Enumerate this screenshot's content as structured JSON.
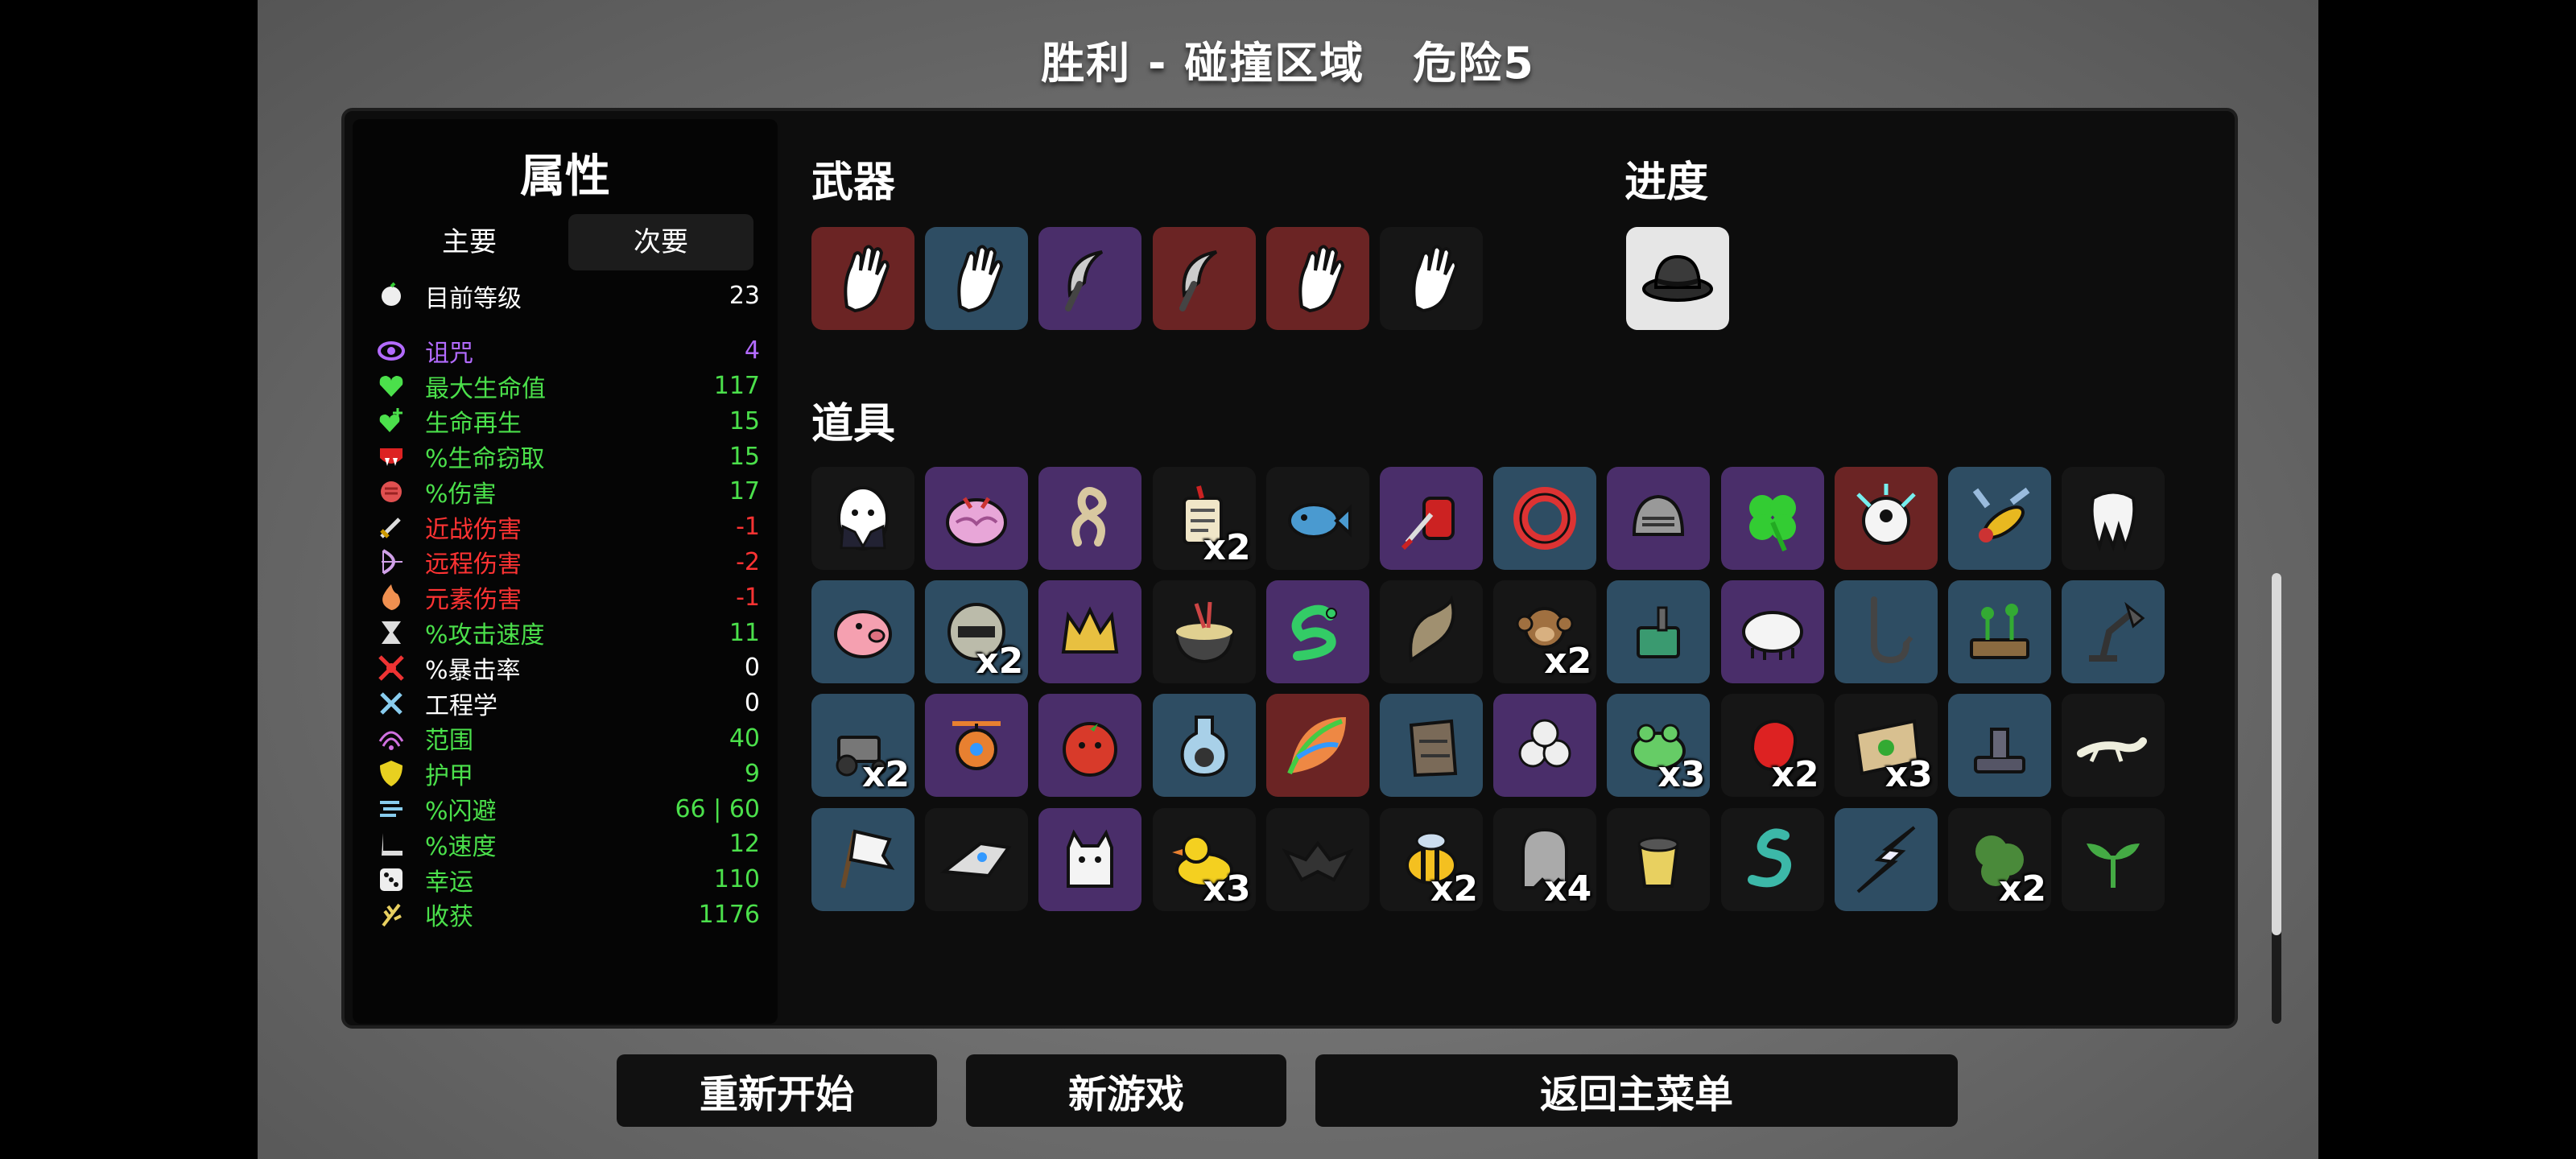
{
  "header": {
    "result": "胜利 - 碰撞区域",
    "danger": "危险5"
  },
  "stats": {
    "title": "属性",
    "tabs": [
      "主要",
      "次要"
    ],
    "active_tab": "次要",
    "level": {
      "label": "目前等级",
      "value": "23",
      "icon": "level-icon"
    },
    "items": [
      {
        "label": "诅咒",
        "value": "4",
        "color": "#b36bff",
        "icon": "curse-eye-icon"
      },
      {
        "label": "最大生命值",
        "value": "117",
        "color": "#4be04b",
        "icon": "heart-icon"
      },
      {
        "label": "生命再生",
        "value": "15",
        "color": "#4be04b",
        "icon": "regen-heart-icon"
      },
      {
        "label": "%生命窃取",
        "value": "15",
        "color": "#4be04b",
        "icon": "lifesteal-fangs-icon"
      },
      {
        "label": "%伤害",
        "value": "17",
        "color": "#4be04b",
        "icon": "damage-fist-icon"
      },
      {
        "label": "近战伤害",
        "value": "-1",
        "color": "#ff3333",
        "icon": "sword-icon"
      },
      {
        "label": "远程伤害",
        "value": "-2",
        "color": "#ff3333",
        "icon": "bow-icon"
      },
      {
        "label": "元素伤害",
        "value": "-1",
        "color": "#ff3333",
        "icon": "flame-icon"
      },
      {
        "label": "%攻击速度",
        "value": "11",
        "color": "#4be04b",
        "icon": "hourglass-icon"
      },
      {
        "label": "%暴击率",
        "value": "0",
        "color": "#ffffff",
        "icon": "crit-icon"
      },
      {
        "label": "工程学",
        "value": "0",
        "color": "#ffffff",
        "icon": "wrench-icon"
      },
      {
        "label": "范围",
        "value": "40",
        "color": "#4be04b",
        "icon": "range-icon"
      },
      {
        "label": "护甲",
        "value": "9",
        "color": "#4be04b",
        "icon": "shield-icon"
      },
      {
        "label": "%闪避",
        "value": "66 | 60",
        "color": "#4be04b",
        "icon": "dodge-icon"
      },
      {
        "label": "%速度",
        "value": "12",
        "color": "#4be04b",
        "icon": "boot-icon"
      },
      {
        "label": "幸运",
        "value": "110",
        "color": "#4be04b",
        "icon": "dice-icon"
      },
      {
        "label": "收获",
        "value": "1176",
        "color": "#4be04b",
        "icon": "harvest-icon"
      }
    ]
  },
  "weapons": {
    "title": "武器",
    "slots": [
      {
        "name": "hand-weapon",
        "tier": 4,
        "icon": "hand-icon"
      },
      {
        "name": "hand-weapon",
        "tier": 2,
        "icon": "hand-icon"
      },
      {
        "name": "sickle-weapon",
        "tier": 3,
        "icon": "sickle-icon"
      },
      {
        "name": "sickle-weapon",
        "tier": 4,
        "icon": "sickle-icon"
      },
      {
        "name": "hand-weapon",
        "tier": 4,
        "icon": "hand-icon"
      },
      {
        "name": "hand-weapon",
        "tier": 1,
        "icon": "hand-icon"
      }
    ]
  },
  "progress": {
    "title": "进度",
    "slots": [
      {
        "name": "bowler-hat",
        "icon": "bowler-hat-icon"
      }
    ]
  },
  "items": {
    "title": "道具",
    "slots": [
      {
        "tier": 1,
        "icon": "egg-icon",
        "qty": ""
      },
      {
        "tier": 3,
        "icon": "brain-icon",
        "qty": ""
      },
      {
        "tier": 3,
        "icon": "rope-icon",
        "qty": ""
      },
      {
        "tier": 1,
        "icon": "scroll-icon",
        "qty": "x2"
      },
      {
        "tier": 1,
        "icon": "fish-icon",
        "qty": ""
      },
      {
        "tier": 3,
        "icon": "blood-bag-icon",
        "qty": ""
      },
      {
        "tier": 2,
        "icon": "ring-icon",
        "qty": ""
      },
      {
        "tier": 3,
        "icon": "knight-helmet-icon",
        "qty": ""
      },
      {
        "tier": 3,
        "icon": "clover-icon",
        "qty": ""
      },
      {
        "tier": 4,
        "icon": "glowing-eye-icon",
        "qty": ""
      },
      {
        "tier": 2,
        "icon": "wasp-icon",
        "qty": ""
      },
      {
        "tier": 1,
        "icon": "tooth-icon",
        "qty": ""
      },
      {
        "tier": 2,
        "icon": "piggy-bank-icon",
        "qty": ""
      },
      {
        "tier": 2,
        "icon": "helmet-icon",
        "qty": "x2"
      },
      {
        "tier": 3,
        "icon": "crown-icon",
        "qty": ""
      },
      {
        "tier": 1,
        "icon": "bowl-icon",
        "qty": ""
      },
      {
        "tier": 3,
        "icon": "snake-icon",
        "qty": ""
      },
      {
        "tier": 1,
        "icon": "horn-icon",
        "qty": ""
      },
      {
        "tier": 1,
        "icon": "monkey-icon",
        "qty": "x2"
      },
      {
        "tier": 2,
        "icon": "turret-icon",
        "qty": ""
      },
      {
        "tier": 3,
        "icon": "tardigrade-icon",
        "qty": ""
      },
      {
        "tier": 2,
        "icon": "hook-icon",
        "qty": ""
      },
      {
        "tier": 2,
        "icon": "garden-icon",
        "qty": ""
      },
      {
        "tier": 2,
        "icon": "lamp-icon",
        "qty": ""
      },
      {
        "tier": 2,
        "icon": "tractor-icon",
        "qty": "x2"
      },
      {
        "tier": 3,
        "icon": "drone-icon",
        "qty": ""
      },
      {
        "tier": 3,
        "icon": "tomato-icon",
        "qty": ""
      },
      {
        "tier": 2,
        "icon": "potion-icon",
        "qty": ""
      },
      {
        "tier": 4,
        "icon": "leaf-icon",
        "qty": ""
      },
      {
        "tier": 2,
        "icon": "armor-icon",
        "qty": ""
      },
      {
        "tier": 3,
        "icon": "skulls-icon",
        "qty": ""
      },
      {
        "tier": 2,
        "icon": "frog-icon",
        "qty": "x3"
      },
      {
        "tier": 1,
        "icon": "red-blob-icon",
        "qty": "x2"
      },
      {
        "tier": 1,
        "icon": "map-icon",
        "qty": "x3"
      },
      {
        "tier": 2,
        "icon": "statue-icon",
        "qty": ""
      },
      {
        "tier": 1,
        "icon": "lizard-icon",
        "qty": ""
      },
      {
        "tier": 2,
        "icon": "flag-icon",
        "qty": ""
      },
      {
        "tier": 1,
        "icon": "spaceship-icon",
        "qty": ""
      },
      {
        "tier": 3,
        "icon": "cat-icon",
        "qty": ""
      },
      {
        "tier": 1,
        "icon": "duck-icon",
        "qty": "x3"
      },
      {
        "tier": 1,
        "icon": "bat-icon",
        "qty": ""
      },
      {
        "tier": 1,
        "icon": "bee-icon",
        "qty": "x2"
      },
      {
        "tier": 1,
        "icon": "ghost-icon",
        "qty": "x4"
      },
      {
        "tier": 1,
        "icon": "cup-icon",
        "qty": ""
      },
      {
        "tier": 1,
        "icon": "worm-icon",
        "qty": ""
      },
      {
        "tier": 2,
        "icon": "lightning-icon",
        "qty": ""
      },
      {
        "tier": 1,
        "icon": "bush-icon",
        "qty": "x2"
      },
      {
        "tier": 1,
        "icon": "sprout-icon",
        "qty": ""
      }
    ]
  },
  "buttons": {
    "restart": "重新开始",
    "new_game": "新游戏",
    "main_menu": "返回主菜单"
  }
}
